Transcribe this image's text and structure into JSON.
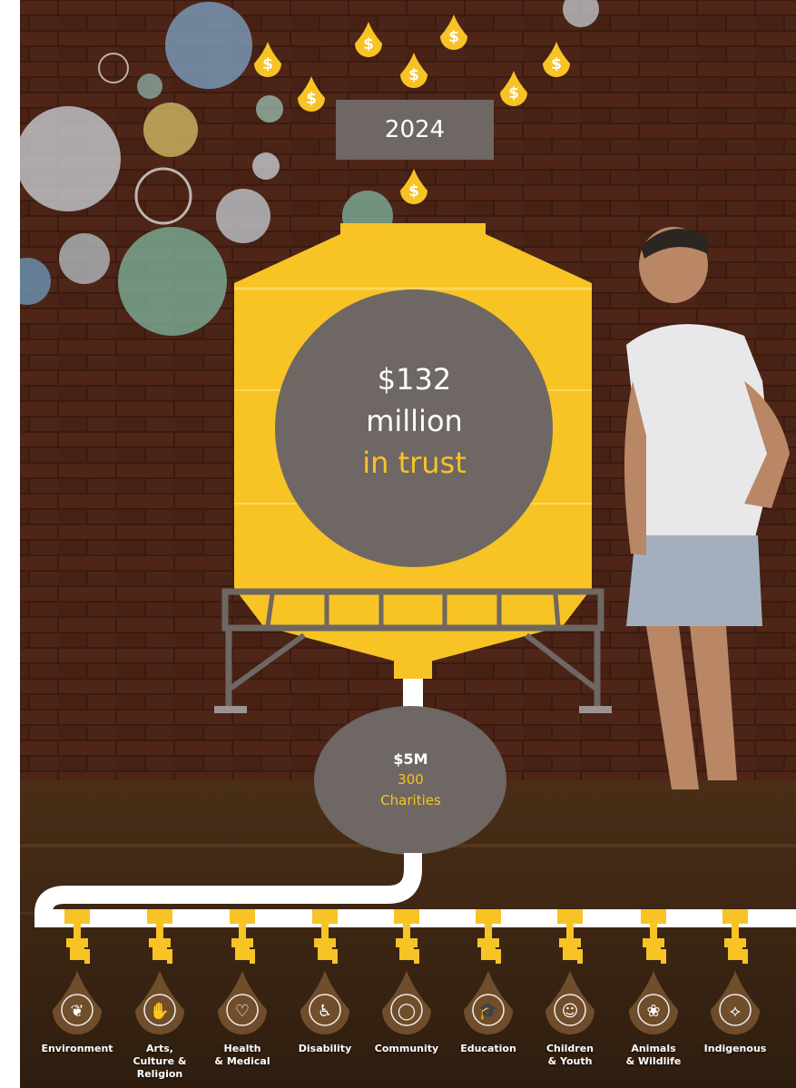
{
  "year": "2024",
  "trust": {
    "amount": "$132",
    "unit": "million",
    "label": "in trust"
  },
  "distribution": {
    "amount": "$5M",
    "count": "300",
    "label": "Charities"
  },
  "coin_symbol": "$",
  "categories": [
    {
      "label": "Environment",
      "icon": "sprout-icon"
    },
    {
      "label": "Arts,\nCulture &\nReligion",
      "icon": "praying-hands-icon"
    },
    {
      "label": "Health\n& Medical",
      "icon": "heart-cross-icon"
    },
    {
      "label": "Disability",
      "icon": "wheelchair-icon"
    },
    {
      "label": "Community",
      "icon": "community-circle-icon"
    },
    {
      "label": "Education",
      "icon": "graduation-cap-icon"
    },
    {
      "label": "Children\n& Youth",
      "icon": "children-icon"
    },
    {
      "label": "Animals\n& Wildlife",
      "icon": "paw-icon"
    },
    {
      "label": "Indigenous",
      "icon": "boomerang-icon"
    }
  ],
  "colors": {
    "accent": "#f7c325",
    "grey": "#6e6763",
    "brick": "#5a2b1a",
    "water": "#3c2412"
  }
}
